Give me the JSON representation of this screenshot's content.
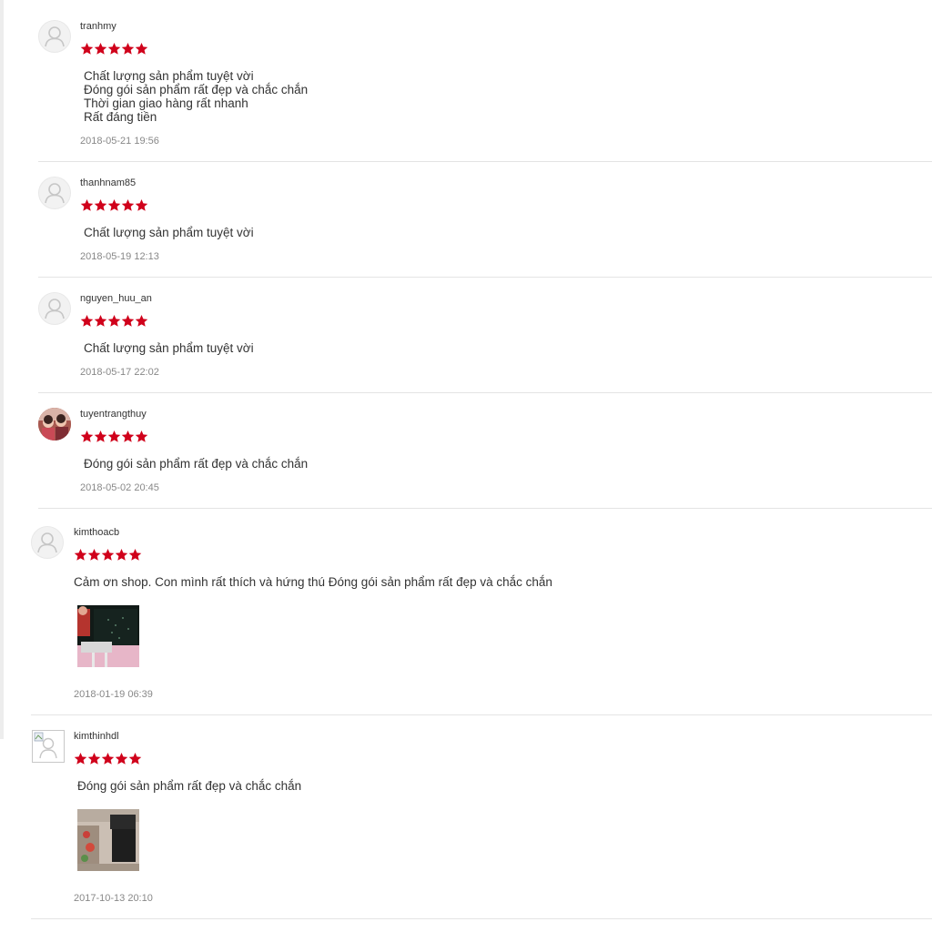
{
  "colors": {
    "star": "#d0011b",
    "separator": "#e4e4e4",
    "date": "#888888"
  },
  "reviews": [
    {
      "username": "tranhmy",
      "stars": 5,
      "lines": [
        "Chất lượng sản phẩm tuyệt vời",
        "Đóng gói sản phẩm rất đẹp và chắc chắn",
        "Thời gian giao hàng rất nhanh",
        "Rất đáng tiền"
      ],
      "date": "2018-05-21 19:56"
    },
    {
      "username": "thanhnam85",
      "stars": 5,
      "lines": [
        "Chất lượng sản phẩm tuyệt vời"
      ],
      "date": "2018-05-19 12:13"
    },
    {
      "username": "nguyen_huu_an",
      "stars": 5,
      "lines": [
        "Chất lượng sản phẩm tuyệt vời"
      ],
      "date": "2018-05-17 22:02"
    },
    {
      "username": "tuyentrangthuy",
      "stars": 5,
      "lines": [
        "Đóng gói sản phẩm rất đẹp và chắc chắn"
      ],
      "date": "2018-05-02 20:45"
    },
    {
      "username": "kimthoacb",
      "stars": 5,
      "lines": [
        "Cảm ơn shop. Con mình rất thích và hứng thú Đóng gói sản phẩm rất đẹp và chắc chắn"
      ],
      "date": "2018-01-19 06:39"
    },
    {
      "username": "kimthinhdl",
      "stars": 5,
      "lines": [
        "Đóng gói sản phẩm rất đẹp và chắc chắn"
      ],
      "date": "2017-10-13 20:10"
    }
  ]
}
